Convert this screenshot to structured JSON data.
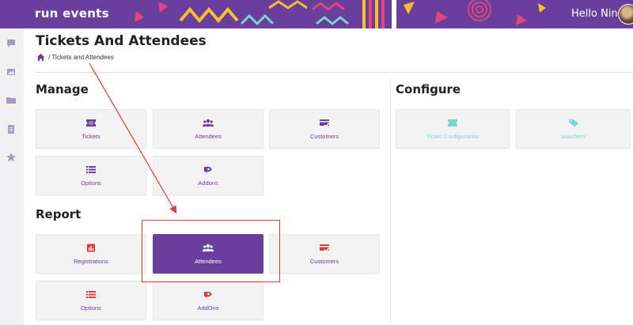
{
  "header": {
    "logo_text": "run events",
    "greeting": "Hello Nina",
    "bg_color": "#6a3e9c"
  },
  "sidebar": {
    "items": [
      {
        "icon": "chat-icon"
      },
      {
        "icon": "image-icon"
      },
      {
        "icon": "folder-icon"
      },
      {
        "icon": "clipboard-icon"
      },
      {
        "icon": "star-icon"
      }
    ]
  },
  "page": {
    "title": "Tickets And Attendees",
    "breadcrumb_separator": "/",
    "breadcrumb_current": "Tickets and Attendees"
  },
  "manage": {
    "title": "Manage",
    "tiles": [
      {
        "label": "Tickets",
        "icon": "ticket-icon"
      },
      {
        "label": "Attendees",
        "icon": "users-icon"
      },
      {
        "label": "Customers",
        "icon": "customer-card-icon"
      },
      {
        "label": "Options",
        "icon": "list-icon"
      },
      {
        "label": "Addons",
        "icon": "addon-icon"
      }
    ]
  },
  "configure": {
    "title": "Configure",
    "tiles": [
      {
        "label": "Ticket Configuration",
        "icon": "ticket-icon"
      },
      {
        "label": "Vouchers",
        "icon": "tag-icon"
      }
    ]
  },
  "report": {
    "title": "Report",
    "tiles": [
      {
        "label": "Registrations",
        "icon": "bar-chart-icon"
      },
      {
        "label": "Attendees",
        "icon": "users-icon",
        "active": true
      },
      {
        "label": "Customers",
        "icon": "customer-card-icon"
      },
      {
        "label": "Options",
        "icon": "list-icon"
      },
      {
        "label": "AddOns",
        "icon": "addon-icon"
      }
    ]
  },
  "colors": {
    "purple": "#6a3e9c",
    "red": "#e03a3a",
    "teal": "#7dd3d1",
    "yellow": "#f6c12d",
    "pink": "#e0457b"
  }
}
